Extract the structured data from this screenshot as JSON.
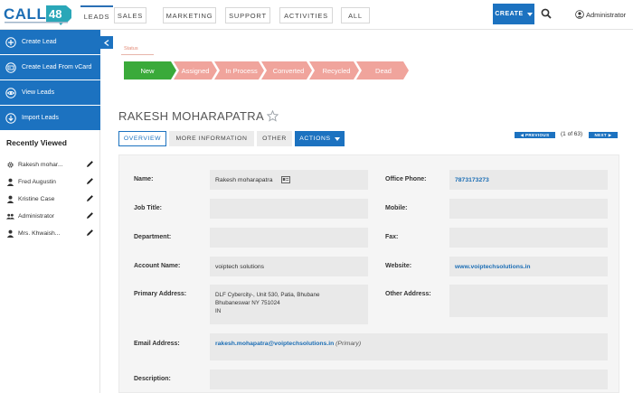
{
  "app": {
    "brand_text": "CALL",
    "brand_number": "48"
  },
  "nav": {
    "tabs": [
      "LEADS",
      "SALES",
      "MARKETING",
      "SUPPORT",
      "ACTIVITIES",
      "ALL"
    ],
    "active_tab": "LEADS",
    "create_label": "CREATE",
    "user_name": "Administrator"
  },
  "sidebar": {
    "actions": [
      {
        "label": "Create Lead",
        "icon": "plus-circle-icon"
      },
      {
        "label": "Create Lead From vCard",
        "icon": "vcard-icon"
      },
      {
        "label": "View Leads",
        "icon": "eye-icon"
      },
      {
        "label": "Import Leads",
        "icon": "download-icon"
      }
    ],
    "recently_viewed_title": "Recently Viewed",
    "recently_viewed": [
      {
        "label": "Rakesh mohar...",
        "icon": "gear-icon"
      },
      {
        "label": "Fred Augustin",
        "icon": "person-icon"
      },
      {
        "label": "Kristine Case",
        "icon": "person-icon"
      },
      {
        "label": "Administrator",
        "icon": "group-icon"
      },
      {
        "label": "Mrs. Khwaish...",
        "icon": "person-icon"
      }
    ]
  },
  "status": {
    "label": "Status",
    "steps": [
      "New",
      "Assigned",
      "In Process",
      "Converted",
      "Recycled",
      "Dead"
    ],
    "current": "New",
    "colors": {
      "current": "#3aaa3a",
      "other": "#f0a49c"
    }
  },
  "record": {
    "title": "RAKESH MOHARAPATRA",
    "tabs": {
      "overview": "OVERVIEW",
      "more": "MORE INFORMATION",
      "other": "OTHER",
      "actions": "ACTIONS"
    },
    "pager": {
      "previous": "PREVIOUS",
      "count": "(1 of 63)",
      "next": "NEXT"
    }
  },
  "fields": {
    "name": {
      "label": "Name:",
      "value": "Rakesh moharapatra"
    },
    "office_phone": {
      "label": "Office Phone:",
      "value": "7873173273"
    },
    "job_title": {
      "label": "Job Title:",
      "value": ""
    },
    "mobile": {
      "label": "Mobile:",
      "value": ""
    },
    "department": {
      "label": "Department:",
      "value": ""
    },
    "fax": {
      "label": "Fax:",
      "value": ""
    },
    "account_name": {
      "label": "Account Name:",
      "value": "voiptech solutions"
    },
    "website": {
      "label": "Website:",
      "value": "www.voiptechsolutions.in"
    },
    "primary_address": {
      "label": "Primary Address:",
      "line1": "DLF Cybercity-, Unit 530, Patia, Bhubane",
      "line2": "Bhubaneswar NY   751024",
      "line3": "IN"
    },
    "other_address": {
      "label": "Other Address:",
      "value": ""
    },
    "email": {
      "label": "Email Address:",
      "value": "rakesh.mohapatra@voiptechsolutions.in",
      "suffix": "(Primary)"
    },
    "description": {
      "label": "Description:",
      "value": ""
    }
  },
  "theme": {
    "accent": "#1c72c0"
  }
}
